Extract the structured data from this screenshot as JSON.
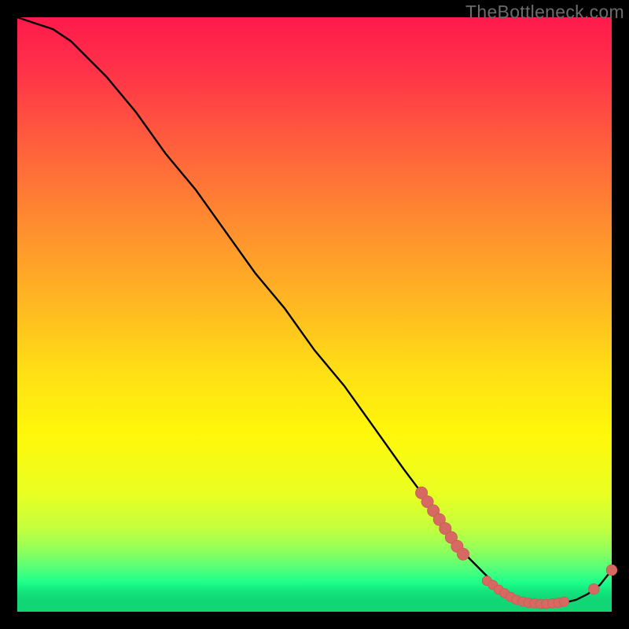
{
  "watermark": "TheBottleneck.com",
  "colors": {
    "curve": "#000000",
    "marker_fill": "#d66a63",
    "marker_stroke": "#c85a54",
    "background_black": "#000000"
  },
  "chart_data": {
    "type": "line",
    "title": "",
    "xlabel": "",
    "ylabel": "",
    "xlim": [
      0,
      100
    ],
    "ylim": [
      0,
      100
    ],
    "axes_visible": false,
    "grid": false,
    "note": "Axes unlabeled; x/y normalized 0–100. Lower y = greener (better). Curve falls from top-left to a minimum near x≈84 then rises slightly.",
    "series": [
      {
        "name": "curve",
        "x": [
          0,
          3,
          6,
          9,
          12,
          15,
          20,
          25,
          30,
          35,
          40,
          45,
          50,
          55,
          60,
          65,
          68,
          70,
          73,
          76,
          78,
          80,
          82,
          84,
          86,
          88,
          90,
          92,
          94,
          96,
          98,
          100
        ],
        "y": [
          100,
          99,
          98,
          96,
          93,
          90,
          84,
          77,
          71,
          64,
          57,
          51,
          44,
          38,
          31,
          24,
          20,
          17,
          13,
          9,
          7,
          5,
          3,
          2,
          1.5,
          1.3,
          1.3,
          1.5,
          2.0,
          3.0,
          4.5,
          7
        ]
      }
    ],
    "markers": [
      {
        "name": "cluster-on-descent",
        "note": "tight run of salmon dots along the falling segment near x 68–75",
        "points": [
          {
            "x": 68,
            "y": 20,
            "r": 1.0
          },
          {
            "x": 69,
            "y": 18.5,
            "r": 1.0
          },
          {
            "x": 70,
            "y": 17,
            "r": 1.0
          },
          {
            "x": 71,
            "y": 15.5,
            "r": 1.0
          },
          {
            "x": 72,
            "y": 14,
            "r": 1.0
          },
          {
            "x": 73,
            "y": 12.5,
            "r": 1.0
          },
          {
            "x": 74,
            "y": 11,
            "r": 1.0
          },
          {
            "x": 75,
            "y": 9.7,
            "r": 1.0
          }
        ]
      },
      {
        "name": "cluster-near-minimum",
        "note": "dense dots along the flat green valley x 79–92",
        "points": [
          {
            "x": 79,
            "y": 5.2,
            "r": 0.8
          },
          {
            "x": 80,
            "y": 4.5,
            "r": 0.8
          },
          {
            "x": 81,
            "y": 3.7,
            "r": 0.8
          },
          {
            "x": 82,
            "y": 3.1,
            "r": 0.8
          },
          {
            "x": 83,
            "y": 2.5,
            "r": 0.8
          },
          {
            "x": 84,
            "y": 2.0,
            "r": 0.8
          },
          {
            "x": 85,
            "y": 1.7,
            "r": 0.8
          },
          {
            "x": 86,
            "y": 1.5,
            "r": 0.8
          },
          {
            "x": 87,
            "y": 1.4,
            "r": 0.8
          },
          {
            "x": 88,
            "y": 1.3,
            "r": 0.8
          },
          {
            "x": 89,
            "y": 1.3,
            "r": 0.8
          },
          {
            "x": 90,
            "y": 1.4,
            "r": 0.8
          },
          {
            "x": 91,
            "y": 1.5,
            "r": 0.8
          },
          {
            "x": 92,
            "y": 1.7,
            "r": 0.8
          }
        ]
      },
      {
        "name": "tail-points",
        "note": "two spaced dots on the rising tail",
        "points": [
          {
            "x": 97,
            "y": 3.8,
            "r": 0.9
          },
          {
            "x": 100,
            "y": 7.0,
            "r": 0.9
          }
        ]
      }
    ]
  }
}
